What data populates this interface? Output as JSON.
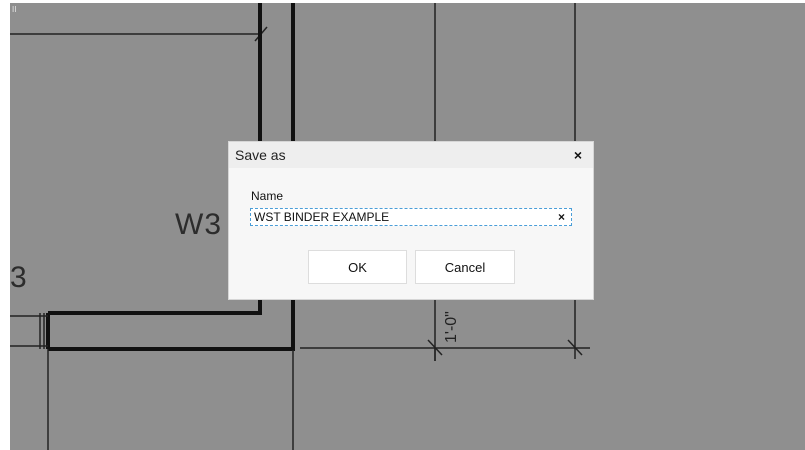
{
  "dialog": {
    "title": "Save as",
    "close_glyph": "×",
    "name_label": "Name",
    "name_value": "WST BINDER EXAMPLE",
    "clear_glyph": "×",
    "ok_label": "OK",
    "cancel_label": "Cancel"
  },
  "drawing": {
    "room_labels": [
      "W3",
      "3"
    ],
    "corner_mark": "II",
    "dimension_text": "1'-0\""
  },
  "colors": {
    "canvas_overlay": "#8f8f8f",
    "dialog_bg": "#f7f7f7",
    "focus_outline": "#4a9ed8"
  }
}
